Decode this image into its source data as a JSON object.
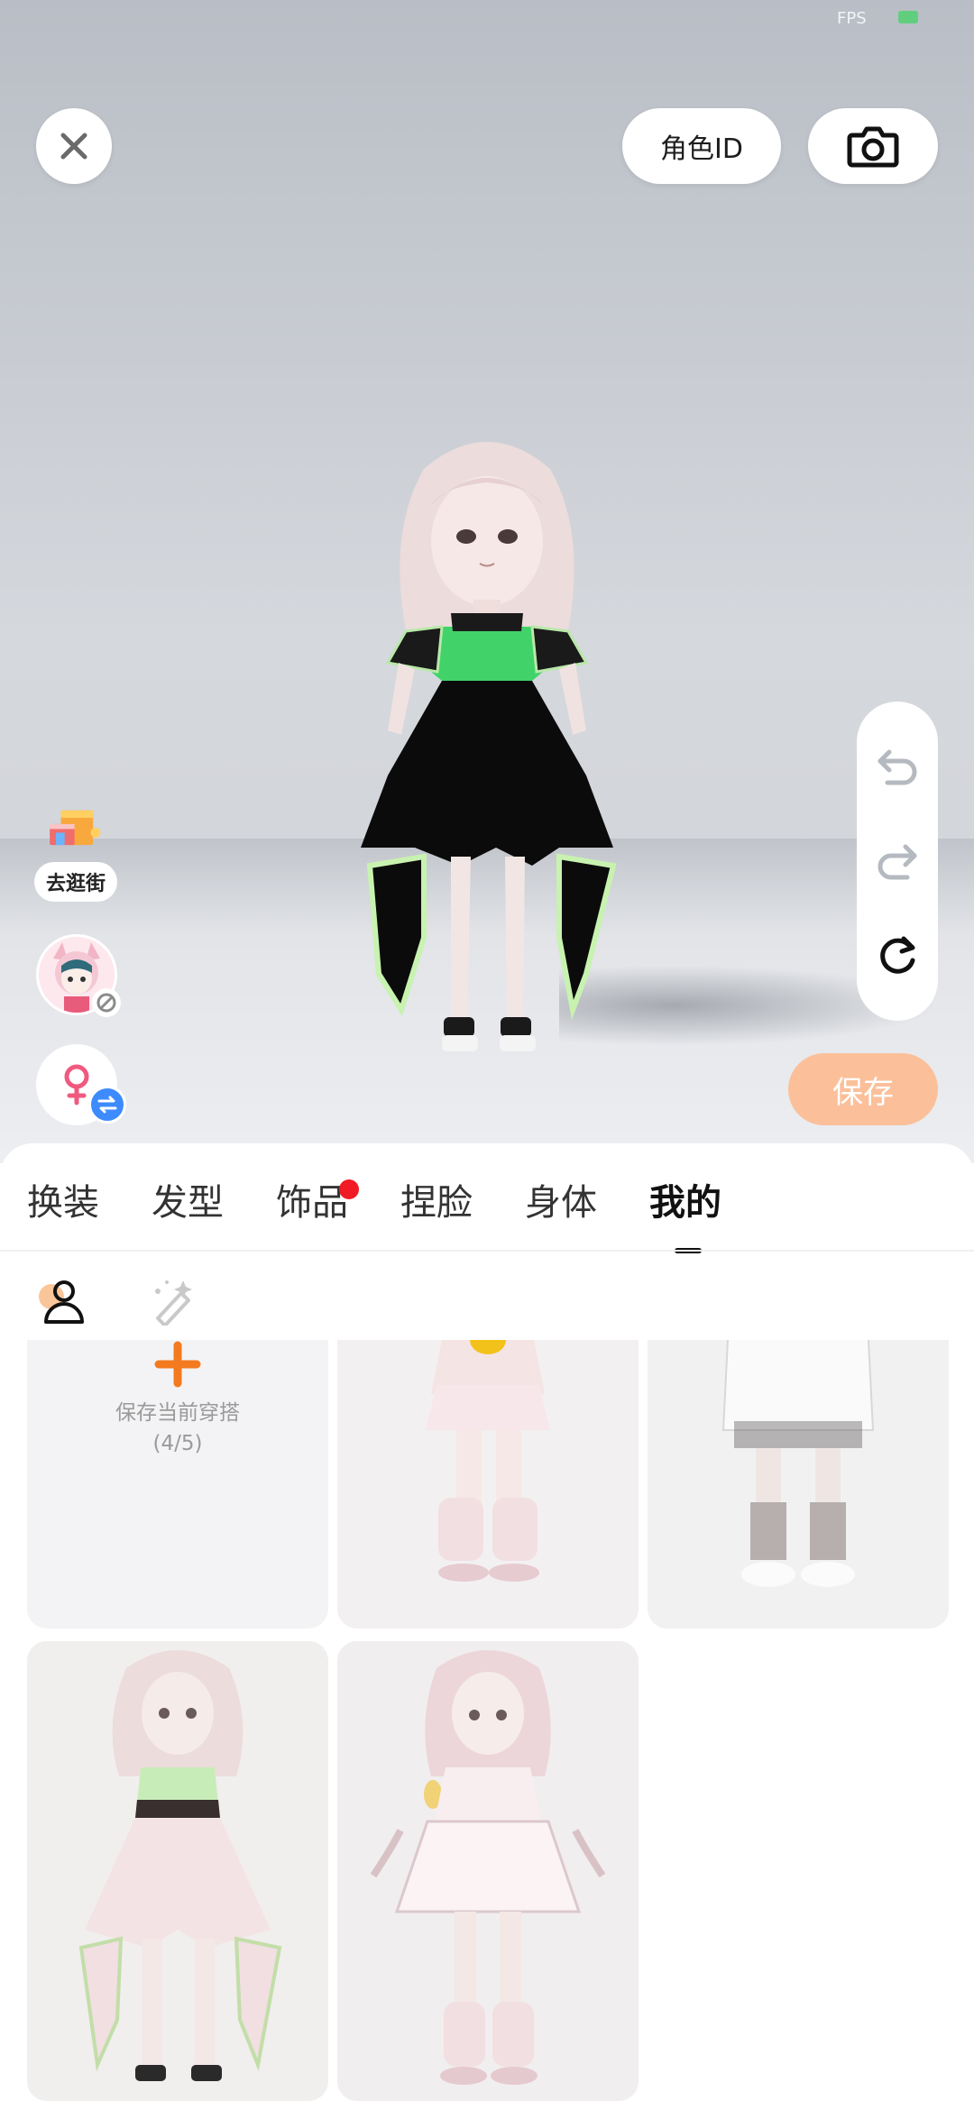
{
  "status": {
    "fps_label": "FPS"
  },
  "header": {
    "role_id_label": "角色ID"
  },
  "left_tools": {
    "shop_label": "去逛街"
  },
  "save_button": "保存",
  "tabs": [
    {
      "label": "换装",
      "active": false,
      "badge": false
    },
    {
      "label": "发型",
      "active": false,
      "badge": false
    },
    {
      "label": "饰品",
      "active": false,
      "badge": true
    },
    {
      "label": "捏脸",
      "active": false,
      "badge": false
    },
    {
      "label": "身体",
      "active": false,
      "badge": false
    },
    {
      "label": "我的",
      "active": true,
      "badge": false
    }
  ],
  "subtabs": [
    {
      "icon": "person-icon",
      "active": true
    },
    {
      "icon": "magic-brush-icon",
      "active": false
    }
  ],
  "outfits": {
    "save_current_label": "保存当前穿搭",
    "save_current_count": "(4/5)"
  },
  "colors": {
    "accent_orange": "#f47a1f",
    "save_button_bg": "#fbc09a",
    "badge_red": "#f01b24",
    "swap_blue": "#3d8bfd"
  }
}
